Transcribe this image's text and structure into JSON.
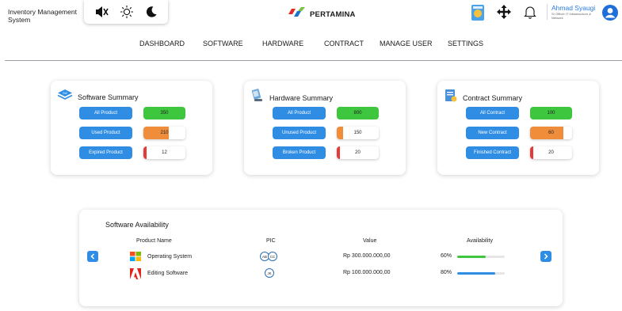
{
  "header": {
    "app_title": "Inventory Management System",
    "brand": "PERTAMINA",
    "user": {
      "name": "Ahmad Syaugi",
      "role": "Sr Officer IT Infrastructure & Network"
    },
    "icons": [
      "mute-icon",
      "sun-icon",
      "moon-icon",
      "app-icon",
      "move-icon",
      "bell-icon",
      "user-avatar-icon"
    ]
  },
  "nav": [
    "DASHBOARD",
    "SOFTWARE",
    "HARDWARE",
    "CONTRACT",
    "MANAGE USER",
    "SETTINGS"
  ],
  "colors": {
    "accent": "#2f8de4",
    "green": "#3ec63e",
    "orange": "#ef8d3a",
    "red": "#e53a3a",
    "brand_red": "#e52a2a",
    "brand_blue": "#1d74c8"
  },
  "summaries": {
    "software": {
      "title": "Software Summary",
      "rows": [
        {
          "label": "All Product",
          "value": "350",
          "status": "green"
        },
        {
          "label": "Used Product",
          "value": "210",
          "status": "orange",
          "level": 0.6
        },
        {
          "label": "Expired Product",
          "value": "12",
          "status": "red"
        }
      ]
    },
    "hardware": {
      "title": "Hardware Summary",
      "rows": [
        {
          "label": "All Product",
          "value": "800",
          "status": "green"
        },
        {
          "label": "Unused Product",
          "value": "150",
          "status": "orange"
        },
        {
          "label": "Broken Product",
          "value": "20",
          "status": "red"
        }
      ]
    },
    "contract": {
      "title": "Contract Summary",
      "rows": [
        {
          "label": "All Contract",
          "value": "100",
          "status": "green"
        },
        {
          "label": "New Contract",
          "value": "60",
          "status": "orange",
          "level": 0.6
        },
        {
          "label": "Finished Contract",
          "value": "20",
          "status": "red"
        }
      ]
    }
  },
  "availability": {
    "title": "Software Availability",
    "columns": [
      "Product Name",
      "PIC",
      "Value",
      "Availability"
    ],
    "rows": [
      {
        "product": "Operating System",
        "icon": "windows-logo-icon",
        "pic": [
          "AB",
          "CC"
        ],
        "value": "Rp 300.000.000,00",
        "availability": "60%",
        "level": 0.6,
        "bar_color": "#3ec63e"
      },
      {
        "product": "Editing Software",
        "icon": "adobe-logo-icon",
        "pic": [
          "JK"
        ],
        "value": "Rp 100.000.000,00",
        "availability": "80%",
        "level": 0.8,
        "bar_color": "#2f8de4"
      }
    ]
  }
}
